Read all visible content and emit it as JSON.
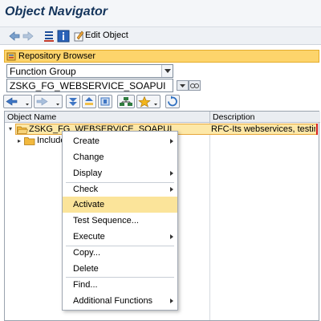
{
  "window": {
    "title": "Object Navigator"
  },
  "toolbar": {
    "edit_object_label": "Edit Object"
  },
  "repository": {
    "header": "Repository Browser",
    "object_type": "Function Group",
    "object_name": "ZSKG_FG_WEBSERVICE_SOAPUI"
  },
  "tree": {
    "col_name": "Object Name",
    "col_desc": "Description",
    "root": {
      "name": "ZSKG_FG_WEBSERVICE_SOAPUI",
      "desc": "RFC-Its webservices, testing in"
    },
    "child": {
      "name": "Include"
    }
  },
  "context_menu": {
    "items": [
      {
        "label": "Create",
        "submenu": true
      },
      {
        "label": "Change",
        "submenu": false
      },
      {
        "label": "Display",
        "submenu": true
      },
      {
        "label": "Check",
        "submenu": true
      },
      {
        "label": "Activate",
        "submenu": false,
        "highlighted": true
      },
      {
        "label": "Test Sequence...",
        "submenu": false
      },
      {
        "label": "Execute",
        "submenu": true
      },
      {
        "label": "Copy...",
        "submenu": false
      },
      {
        "label": "Delete",
        "submenu": false
      },
      {
        "label": "Find...",
        "submenu": false
      },
      {
        "label": "Additional Functions",
        "submenu": true
      }
    ]
  },
  "colors": {
    "highlight": "#fbe49a",
    "header_bar": "#fdd46b",
    "title": "#14345b"
  }
}
